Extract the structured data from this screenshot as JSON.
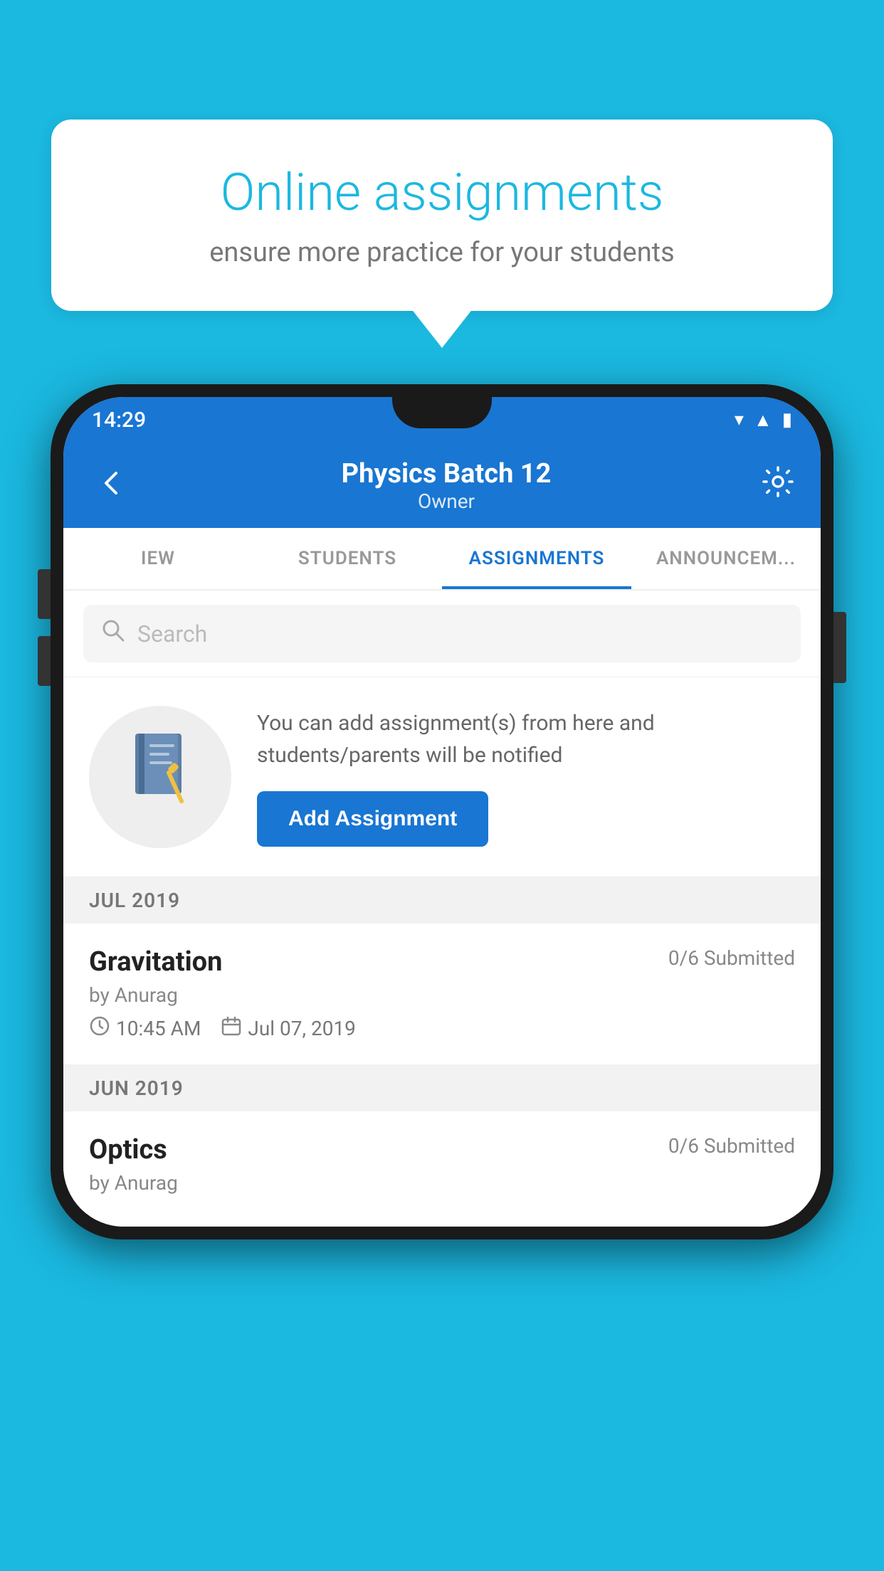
{
  "background": {
    "color": "#1bb8e0"
  },
  "speech_bubble": {
    "title": "Online assignments",
    "subtitle": "ensure more practice for your students"
  },
  "status_bar": {
    "time": "14:29",
    "wifi_icon": "wifi",
    "signal_icon": "signal",
    "battery_icon": "battery"
  },
  "app_bar": {
    "back_label": "←",
    "title": "Physics Batch 12",
    "subtitle": "Owner",
    "settings_icon": "gear"
  },
  "tabs": [
    {
      "label": "IEW",
      "active": false
    },
    {
      "label": "STUDENTS",
      "active": false
    },
    {
      "label": "ASSIGNMENTS",
      "active": true
    },
    {
      "label": "ANNOUNCEM...",
      "active": false
    }
  ],
  "search": {
    "placeholder": "Search"
  },
  "promo": {
    "icon": "📓",
    "text": "You can add assignment(s) from here and students/parents will be notified",
    "button_label": "Add Assignment"
  },
  "assignments": {
    "sections": [
      {
        "month_label": "JUL 2019",
        "items": [
          {
            "name": "Gravitation",
            "submitted": "0/6 Submitted",
            "by": "by Anurag",
            "time": "10:45 AM",
            "date": "Jul 07, 2019"
          }
        ]
      },
      {
        "month_label": "JUN 2019",
        "items": [
          {
            "name": "Optics",
            "submitted": "0/6 Submitted",
            "by": "by Anurag",
            "time": "",
            "date": ""
          }
        ]
      }
    ]
  }
}
